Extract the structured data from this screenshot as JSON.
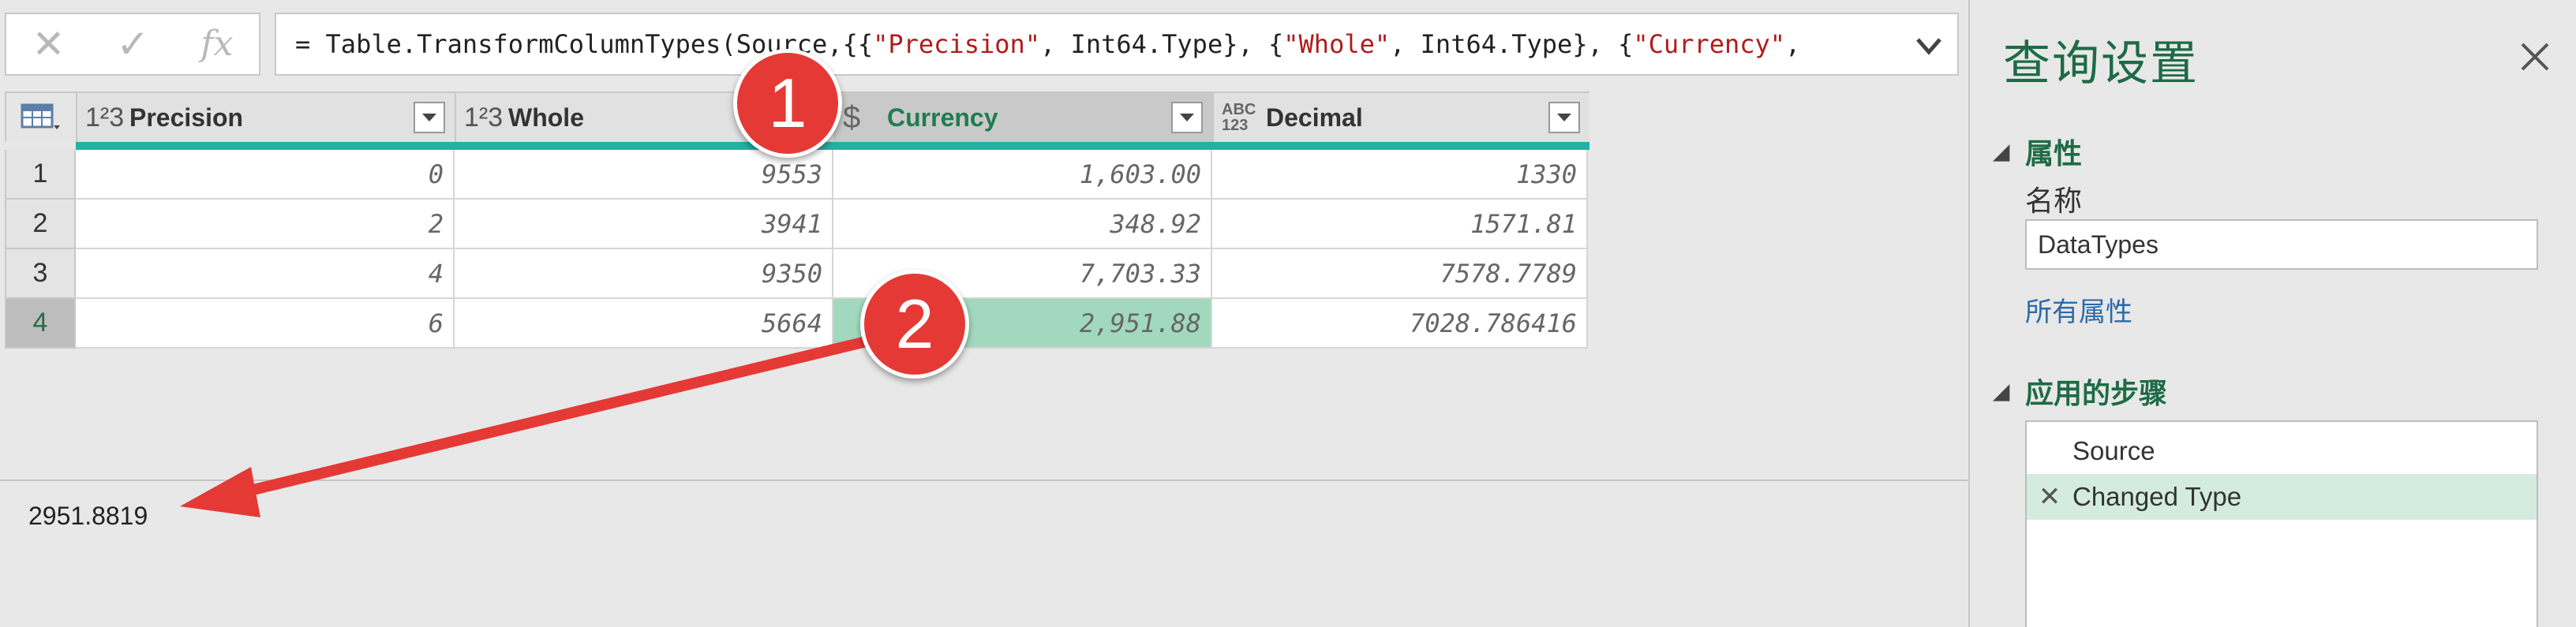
{
  "formula_bar": {
    "buttons": {
      "cancel_icon": "close-icon",
      "commit_icon": "check-icon",
      "fx_label": "fx"
    },
    "formula_parts": [
      {
        "text": "= Table.TransformColumnTypes(Source,{{",
        "kind": "code"
      },
      {
        "text": "\"Precision\"",
        "kind": "string"
      },
      {
        "text": ", Int64.Type}, {",
        "kind": "code"
      },
      {
        "text": "\"Whole\"",
        "kind": "string"
      },
      {
        "text": ", Int64.Type}, {",
        "kind": "code"
      },
      {
        "text": "\"Currency\"",
        "kind": "string"
      },
      {
        "text": ",",
        "kind": "code"
      }
    ],
    "expand_icon": "chevron-down-icon",
    "string_color": "#b01c1c"
  },
  "grid": {
    "columns": [
      {
        "name": "Precision",
        "type_icon": "1²3"
      },
      {
        "name": "Whole",
        "type_icon": "1²3"
      },
      {
        "name": "Currency",
        "type_icon": "$",
        "selected": true
      },
      {
        "name": "Decimal",
        "type_icon": "ABC\n123"
      }
    ],
    "rows": [
      {
        "num": "1",
        "cells": [
          "0",
          "9553",
          "1,603.00",
          "1330"
        ]
      },
      {
        "num": "2",
        "cells": [
          "2",
          "3941",
          "348.92",
          "1571.81"
        ]
      },
      {
        "num": "3",
        "cells": [
          "4",
          "9350",
          "7,703.33",
          "7578.7789"
        ]
      },
      {
        "num": "4",
        "cells": [
          "6",
          "5664",
          "2,951.88",
          "7028.786416"
        ],
        "selected": true
      }
    ],
    "quality_bar_color": "#1fb3a5",
    "selected_cell_color": "#a2d9be"
  },
  "preview": {
    "value": "2951.8819"
  },
  "query_settings": {
    "title": "查询设置",
    "properties_header": "属性",
    "name_label": "名称",
    "name_value": "DataTypes",
    "all_properties_link": "所有属性",
    "applied_steps_header": "应用的步骤",
    "steps": [
      {
        "label": "Source",
        "selected": false
      },
      {
        "label": "Changed Type",
        "selected": true
      }
    ],
    "accent_color": "#1e6b45"
  },
  "callouts": [
    {
      "label": "1"
    },
    {
      "label": "2"
    }
  ]
}
